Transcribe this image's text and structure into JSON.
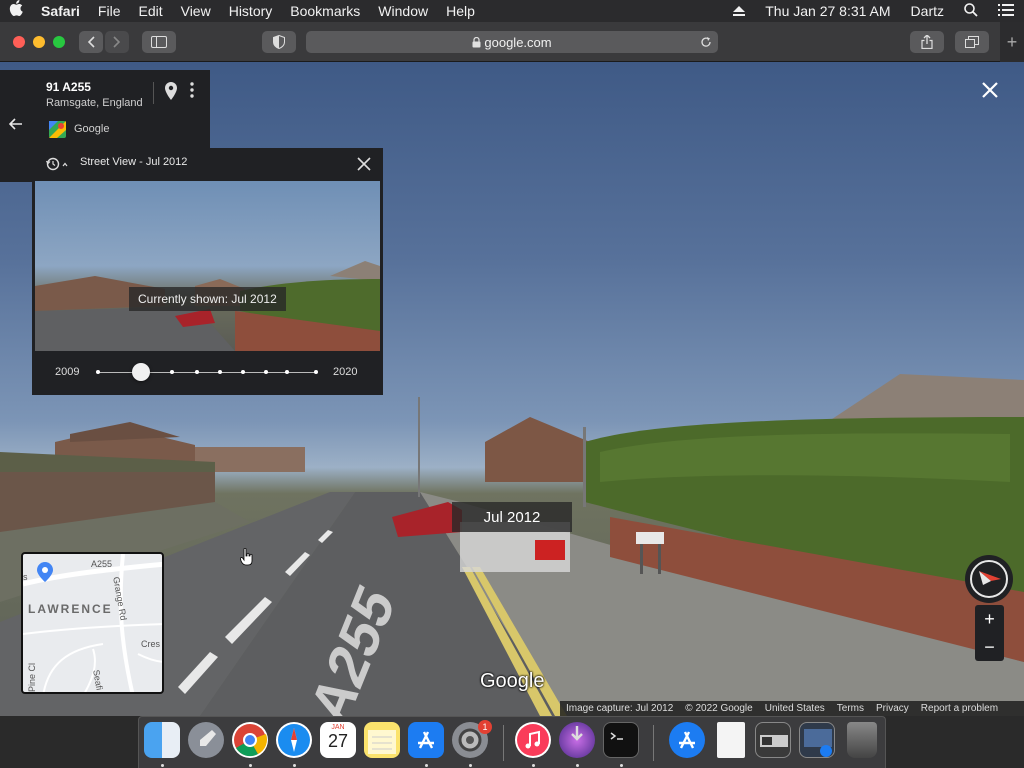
{
  "menubar": {
    "app_name": "Safari",
    "items": [
      "File",
      "Edit",
      "View",
      "History",
      "Bookmarks",
      "Window",
      "Help"
    ],
    "clock": "Thu Jan 27  8:31 AM",
    "user": "Dartz"
  },
  "browser": {
    "url": "google.com"
  },
  "info_card": {
    "title": "91 A255",
    "subtitle": "Ramsgate, England",
    "provider": "Google"
  },
  "time_panel": {
    "header": "Street View - Jul 2012",
    "currently_shown": "Currently shown: Jul 2012",
    "start_year": "2009",
    "end_year": "2020",
    "selected_fraction": 0.2
  },
  "streetview": {
    "date_label": "Jul 2012",
    "road_marking": "A255",
    "logo": "Google"
  },
  "minimap": {
    "labels": [
      "A255",
      "Grange Rd",
      "LAWRENCE",
      "Cres",
      "Pine Cl",
      "Seafi"
    ]
  },
  "footer": {
    "links": [
      "Image capture: Jul 2012",
      "© 2022 Google",
      "United States",
      "Terms",
      "Privacy",
      "Report a problem"
    ]
  },
  "calendar": {
    "month": "JAN",
    "day": "27"
  },
  "badges": {
    "system_prefs": "1"
  },
  "colors": {
    "panel_bg": "#202124",
    "accent_red": "#e34133"
  }
}
